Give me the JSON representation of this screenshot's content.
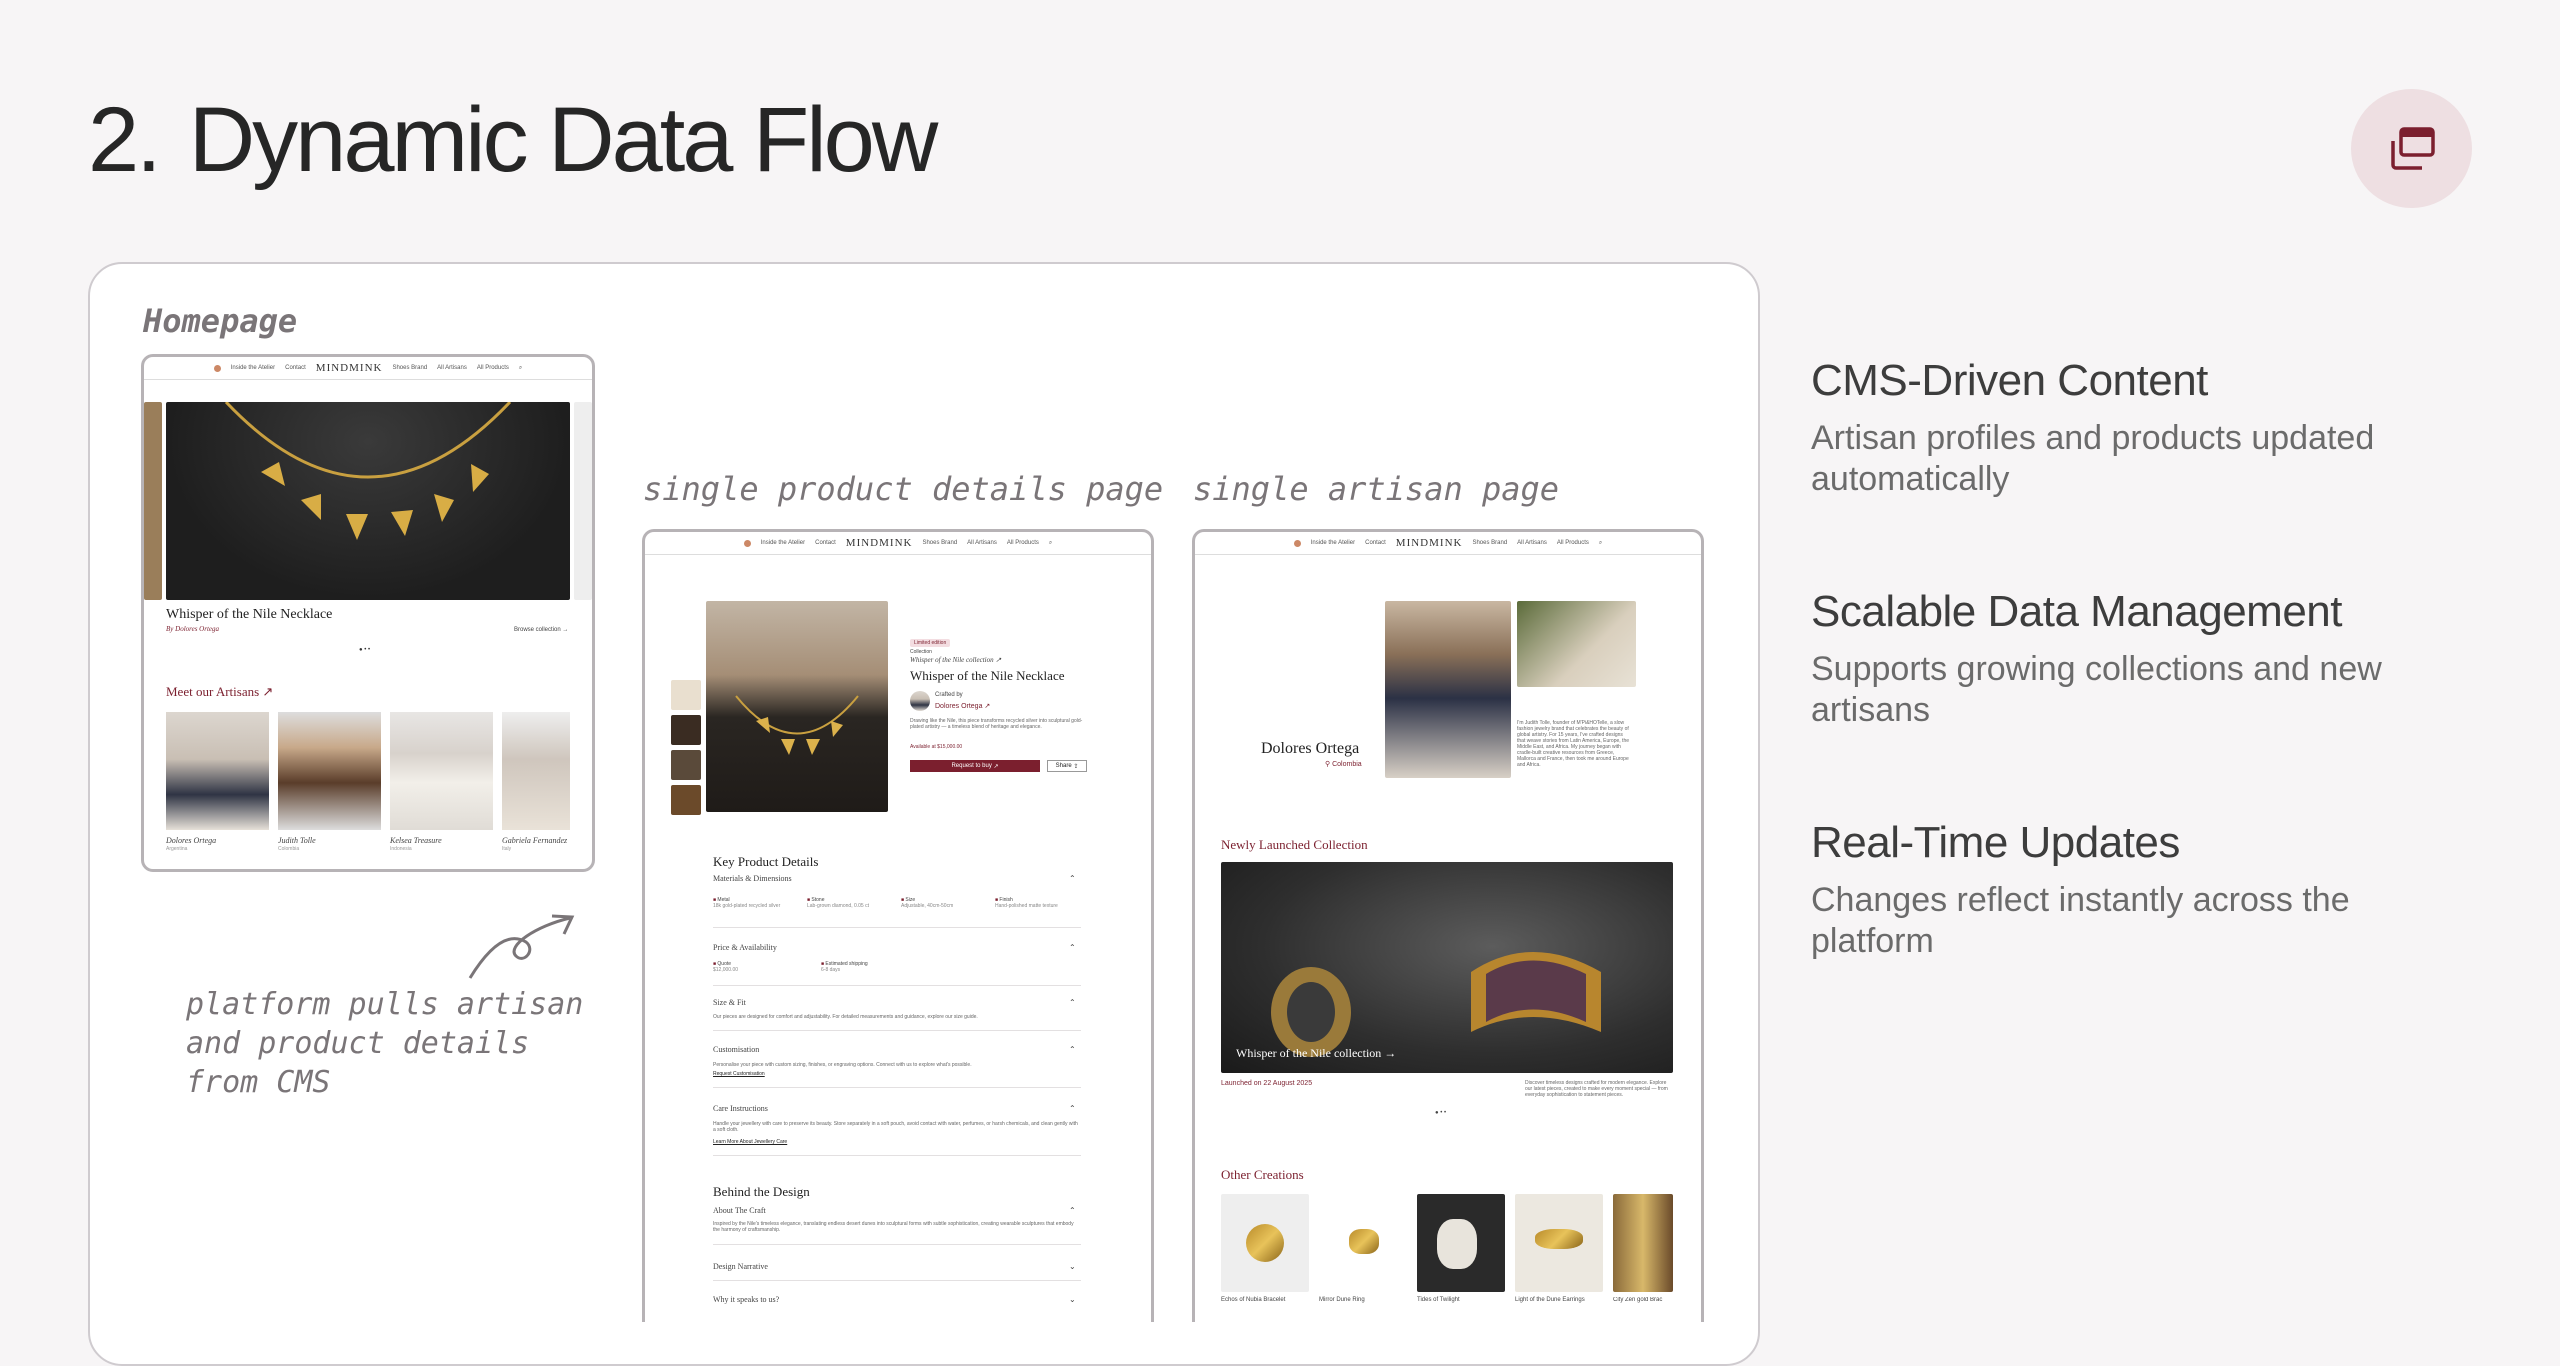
{
  "heading": {
    "number": "2.",
    "title": "Dynamic Data Flow"
  },
  "corner_button": {
    "icon": "copy-windows-icon"
  },
  "labels": {
    "homepage": "Homepage",
    "product": "single product details page",
    "artisan": "single artisan page",
    "note": "platform pulls artisan and product details from CMS"
  },
  "nav": {
    "links_left": [
      "Inside the Atelier",
      "Contact"
    ],
    "logo": "MINDMINK",
    "links_right": [
      "Shoes Brand",
      "All Artisans",
      "All Products"
    ]
  },
  "home": {
    "hero_title": "Whisper of the Nile Necklace",
    "hero_sub": "By Dolores Ortega",
    "hero_link": "Browse collection",
    "section_title": "Meet our Artisans",
    "artisans": [
      {
        "name": "Dolores Ortega",
        "country": "Argentina"
      },
      {
        "name": "Judith Tolle",
        "country": "Colombia"
      },
      {
        "name": "Kelsea Treasure",
        "country": "Indonesia"
      },
      {
        "name": "Gabriela Fernandez",
        "country": "Italy"
      }
    ]
  },
  "product": {
    "badge": "Limited edition",
    "collection_label": "Collection",
    "collection": "Whisper of the Nile collection",
    "title": "Whisper of the Nile Necklace",
    "crafted_by": "Crafted by",
    "artisan": "Dolores Ortega",
    "description": "Drawing like the Nile, this piece transforms recycled silver into sculptural gold-plated artistry — a timeless blend of heritage and elegance.",
    "availability": "Available at $15,000.00",
    "primary_btn": "Request to buy",
    "secondary_btn": "Share",
    "key_title": "Key Product Details",
    "materials_title": "Materials & Dimensions",
    "materials": [
      {
        "k": "Metal",
        "v": "18k gold-plated recycled silver"
      },
      {
        "k": "Stone",
        "v": "Lab-grown diamond, 0.05 ct"
      },
      {
        "k": "Size",
        "v": "Adjustable, 40cm-50cm"
      },
      {
        "k": "Finish",
        "v": "Hand-polished matte texture"
      }
    ],
    "price_title": "Price & Availability",
    "price": [
      {
        "k": "Quote",
        "v": "$12,000.00"
      },
      {
        "k": "Estimated shipping",
        "v": "6-8 days"
      }
    ],
    "size_title": "Size & Fit",
    "size_text": "Our pieces are designed for comfort and adjustability. For detailed measurements and guidance, explore our size guide.",
    "custom_title": "Customisation",
    "custom_text": "Personalise your piece with custom sizing, finishes, or engraving options. Connect with us to explore what's possible.",
    "custom_link": "Request Customisation",
    "care_title": "Care Instructions",
    "care_text": "Handle your jewellery with care to preserve its beauty. Store separately in a soft pouch, avoid contact with water, perfumes, or harsh chemicals, and clean gently with a soft cloth.",
    "care_link": "Learn More About Jewellery Care",
    "behind_title": "Behind the Design",
    "craft_title": "About The Craft",
    "craft_text": "Inspired by the Nile's timeless elegance, translating endless desert dunes into sculptural forms with subtle sophistication, creating wearable sculptures that embody the harmony of craftsmanship.",
    "narrative_title": "Design Narrative",
    "why_title": "Why it speaks to us?"
  },
  "artisan_page": {
    "name": "Dolores Ortega",
    "country": "Colombia",
    "bio": "I'm Judith Tolle, founder of M'Pi&HOTelle, a slow fashion jewelry brand that celebrates the beauty of global artistry. For 15 years, I've crafted designs that weave stories from Latin America, Europe, the Middle East, and Africa. My journey began with cradle-built creative resources from Greece, Mallorca and France, then took me around Europe and Africa.",
    "collection_title": "Newly Launched Collection",
    "collection_name": "Whisper of the Nile collection",
    "launched": "Launched on 22 August 2025",
    "collection_desc": "Discover timeless designs crafted for modern elegance. Explore our latest pieces, created to make every moment special — from everyday sophistication to statement pieces.",
    "other_title": "Other Creations",
    "others": [
      "Echos of Nubia Bracelet",
      "Mirror Dune Ring",
      "Tides of Twilight",
      "Light of the Dune Earrings",
      "City Zen gold Brac"
    ]
  },
  "features": [
    {
      "title": "CMS-Driven Content",
      "text": "Artisan profiles and products updated automatically"
    },
    {
      "title": "Scalable Data Management",
      "text": "Supports growing collections and new artisans"
    },
    {
      "title": "Real-Time Updates",
      "text": "Changes reflect instantly across the platform"
    }
  ]
}
